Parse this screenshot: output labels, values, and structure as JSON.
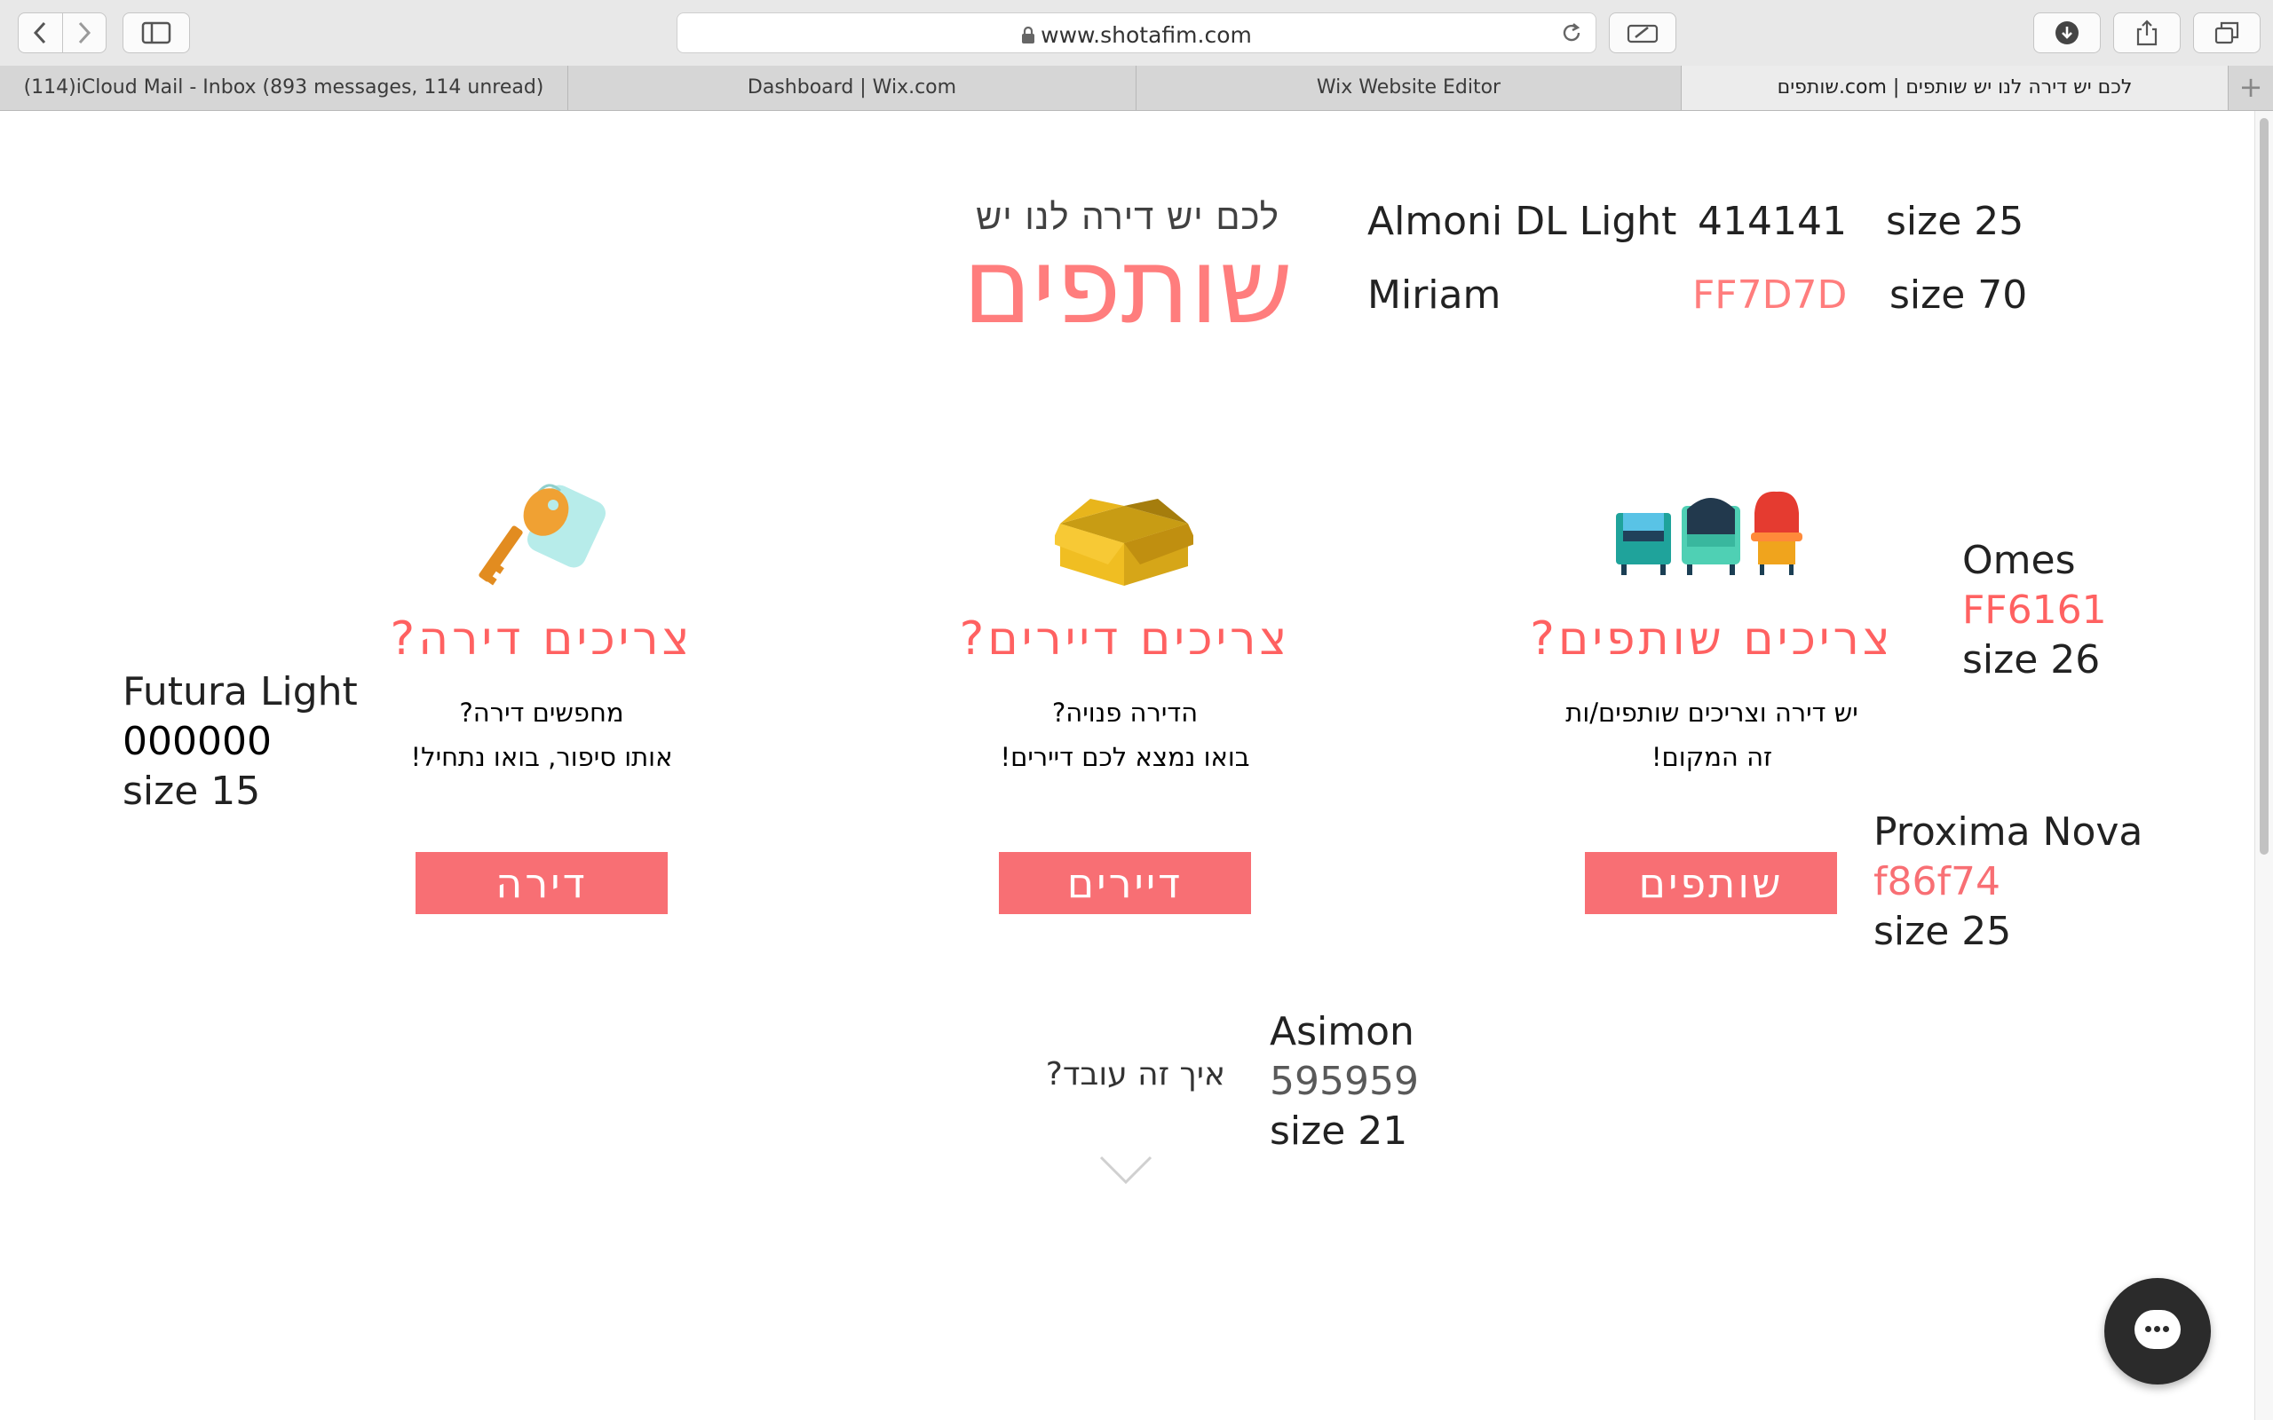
{
  "browser": {
    "url": "www.shotafim.com",
    "tabs": [
      {
        "label": "(114)iCloud Mail - Inbox (893 messages, 114 unread)",
        "active": false
      },
      {
        "label": "Dashboard | Wix.com",
        "active": false
      },
      {
        "label": "Wix Website Editor",
        "active": false
      },
      {
        "label": "שותפים.com | לכם יש דירה לנו יש שותפים",
        "active": true
      }
    ],
    "new_tab": "+"
  },
  "logo": {
    "tagline": "לכם יש דירה לנו יש",
    "name": "שותפים"
  },
  "notes": {
    "logo_tagline": {
      "font": "Almoni DL Light",
      "color": "414141",
      "size": "size 25"
    },
    "logo_name": {
      "font": "Miriam",
      "color": "FF7D7D",
      "size": "size 70"
    },
    "headings": {
      "font": "Omes",
      "color": "FF6161",
      "size": "size 26"
    },
    "body": {
      "font": "Futura Light",
      "color": "000000",
      "size": "size 15"
    },
    "buttons": {
      "font": "Proxima Nova",
      "color": "f86f74",
      "size": "size 25"
    },
    "how": {
      "font": "Asimon",
      "color": "595959",
      "size": "size 21"
    }
  },
  "columns": [
    {
      "heading": "צריכים דירה?",
      "line1": "מחפשים דירה?",
      "line2": "אותו סיפור, בואו נתחיל!",
      "button": "דירה"
    },
    {
      "heading": "צריכים דיירים?",
      "line1": "הדירה פנויה?",
      "line2": "בואו נמצא לכם דיירים!",
      "button": "דיירים"
    },
    {
      "heading": "צריכים שותפים?",
      "line1": "יש דירה וצריכים שותפים/ות",
      "line2": "זה המקום!",
      "button": "שותפים"
    }
  ],
  "how_it_works": "איך זה עובד?",
  "colors": {
    "logo_pink": "#FF7D7D",
    "heading_red": "#FF6161",
    "button_pink": "#f86f74"
  },
  "icons": [
    "back-icon",
    "forward-icon",
    "sidebar-icon",
    "lock-icon",
    "reload-icon",
    "markup-icon",
    "download-icon",
    "share-icon",
    "tabs-icon",
    "key-icon",
    "box-icon",
    "armchairs-icon",
    "chevron-down-icon",
    "chat-icon"
  ]
}
